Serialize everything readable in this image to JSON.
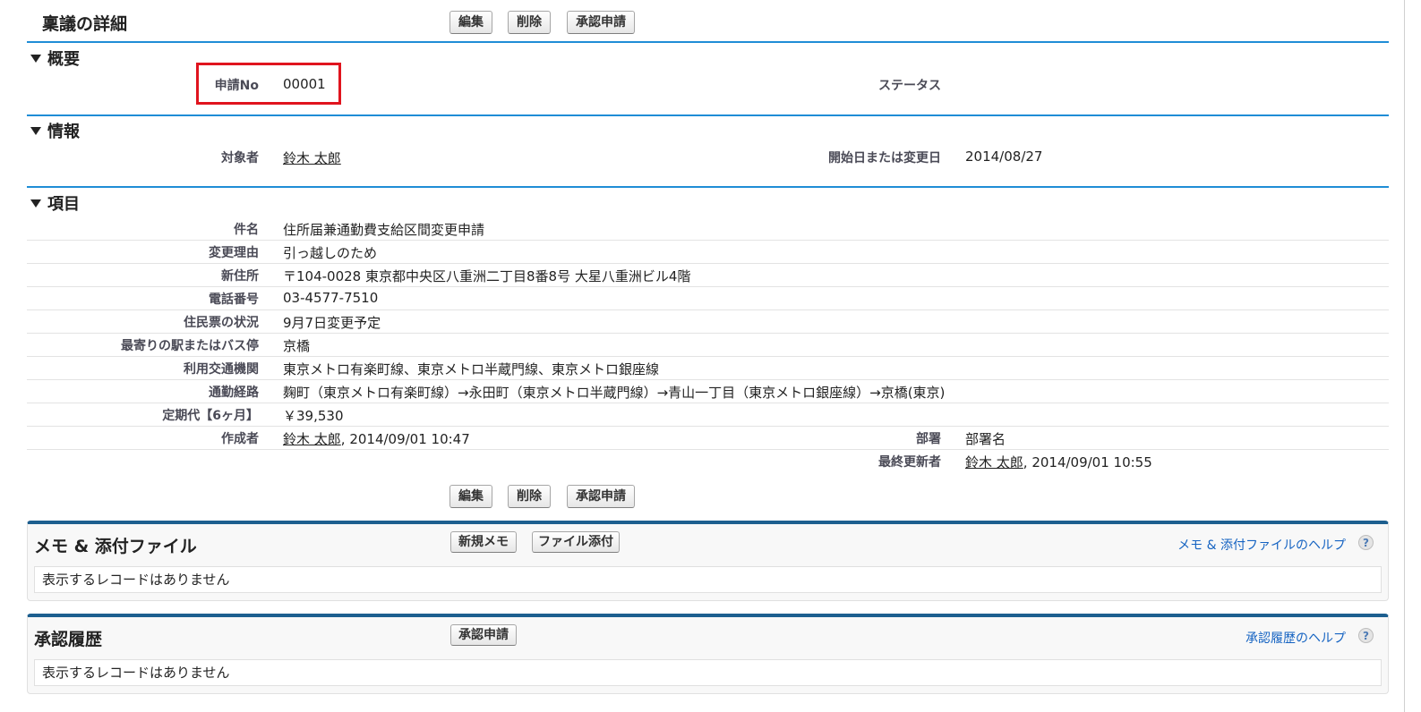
{
  "page": {
    "title": "稟議の詳細",
    "buttons": {
      "edit": "編集",
      "delete": "削除",
      "submit_approval": "承認申請"
    }
  },
  "sections": {
    "overview": {
      "title": "概要",
      "application_no": {
        "label": "申請No",
        "value": "00001"
      },
      "status": {
        "label": "ステータス",
        "value": ""
      }
    },
    "info": {
      "title": "情報",
      "target": {
        "label": "対象者",
        "value": "鈴木 太郎"
      },
      "start_date": {
        "label": "開始日または変更日",
        "value": "2014/08/27"
      }
    },
    "items": {
      "title": "項目",
      "rows": [
        {
          "label": "件名",
          "value": "住所届兼通勤費支給区間変更申請"
        },
        {
          "label": "変更理由",
          "value": "引っ越しのため"
        },
        {
          "label": "新住所",
          "value": "〒104-0028  東京都中央区八重洲二丁目8番8号  大星八重洲ビル4階"
        },
        {
          "label": "電話番号",
          "value": "03-4577-7510"
        },
        {
          "label": "住民票の状況",
          "value": "9月7日変更予定"
        },
        {
          "label": "最寄りの駅またはバス停",
          "value": "京橋"
        },
        {
          "label": "利用交通機関",
          "value": "東京メトロ有楽町線、東京メトロ半蔵門線、東京メトロ銀座線"
        },
        {
          "label": "通勤経路",
          "value": "麹町（東京メトロ有楽町線）→永田町（東京メトロ半蔵門線）→青山一丁目（東京メトロ銀座線）→京橋(東京)"
        },
        {
          "label": "定期代【6ヶ月】",
          "value": "￥39,530"
        }
      ],
      "created_by": {
        "label": "作成者",
        "user": "鈴木 太郎",
        "timestamp": ", 2014/09/01 10:47"
      },
      "department": {
        "label": "部署",
        "value": "部署名"
      },
      "last_modified_by": {
        "label": "最終更新者",
        "user": "鈴木 太郎",
        "timestamp": ", 2014/09/01 10:55"
      }
    }
  },
  "notes_panel": {
    "title": "メモ & 添付ファイル",
    "new_note_button": "新規メモ",
    "attach_file_button": "ファイル添付",
    "help_link": "メモ & 添付ファイルのヘルプ",
    "help_icon": "?",
    "empty_message": "表示するレコードはありません"
  },
  "approval_panel": {
    "title": "承認履歴",
    "submit_button": "承認申請",
    "help_link": "承認履歴のヘルプ",
    "help_icon": "?",
    "empty_message": "表示するレコードはありません"
  },
  "colors": {
    "section_line": "#1f8dd6",
    "panel_top_border": "#1d5f8f",
    "highlight_box": "#e0141e",
    "help_link": "#1563c2"
  }
}
